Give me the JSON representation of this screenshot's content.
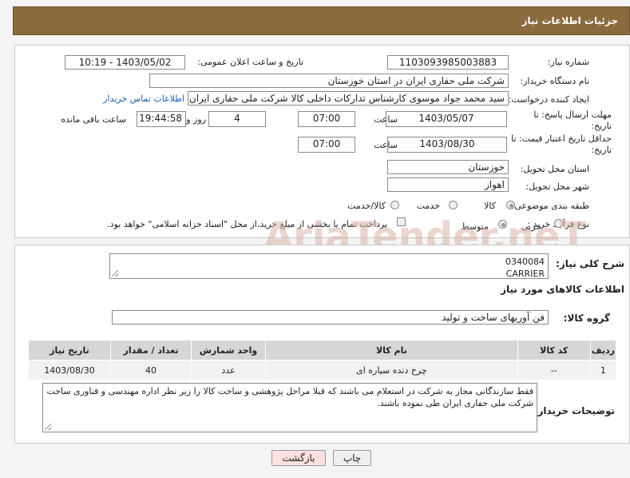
{
  "header": {
    "title": "جزئیات اطلاعات نیاز"
  },
  "form": {
    "need_number": {
      "label": "شماره نیاز:",
      "value": "1103093985003883"
    },
    "announce_datetime": {
      "label": "تاریخ و ساعت اعلان عمومی:",
      "value": "1403/05/02 - 10:19"
    },
    "buyer_org": {
      "label": "نام دستگاه خریدار:",
      "value": "شرکت ملی حفاری ایران در استان خوزستان"
    },
    "requester": {
      "label": "ایجاد کننده درخواست:",
      "value": "سید محمد جواد موسوی کارشناس تدارکات داخلی کالا شرکت ملی حفاری ایران",
      "contact_link": "اطلاعات تماس خریدار"
    },
    "reply_deadline": {
      "label": "مهلت ارسال پاسخ: تا تاریخ:",
      "date": "1403/05/07",
      "time_label": "ساعت",
      "time": "07:00",
      "days": "4",
      "days_label": "روز و",
      "remaining": "19:44:58",
      "remaining_label": "ساعت باقی مانده"
    },
    "price_validity": {
      "label": "حداقل تاریخ اعتبار قیمت: تا تاریخ:",
      "date": "1403/08/30",
      "time_label": "ساعت",
      "time": "07:00"
    },
    "delivery_province": {
      "label": "استان محل تحویل:",
      "value": "خوزستان"
    },
    "delivery_city": {
      "label": "شهر محل تحویل:",
      "value": "اهواز"
    },
    "category": {
      "label": "طبقه بندی موضوعی:",
      "options": [
        "کالا",
        "خدمت",
        "کالا/خدمت"
      ],
      "selected": "کالا"
    },
    "purchase_type": {
      "label": "نوع فرآیند خرید :",
      "options": [
        "جزیی",
        "متوسط"
      ],
      "selected": "متوسط",
      "note": "پرداخت تمام یا بخشی از مبلغ خرید،از محل \"اسناد خزانه اسلامی\" خواهد بود."
    }
  },
  "description": {
    "label": "شرح کلی نیاز:",
    "line1": "0340084",
    "line2": "CARRIER"
  },
  "goods_info": {
    "title": "اطلاعات کالاهای مورد نیاز"
  },
  "goods_group": {
    "label": "گروه کالا:",
    "value": "فن آوریهای ساخت و تولید"
  },
  "table": {
    "headers": [
      "ردیف",
      "کد کالا",
      "نام کالا",
      "واحد شمارش",
      "تعداد / مقدار",
      "تاریخ نیاز"
    ],
    "rows": [
      [
        "1",
        "--",
        "چرخ دنده سیاره ای",
        "عدد",
        "40",
        "1403/08/30"
      ]
    ]
  },
  "buyer_notes": {
    "label": "توضیحات خریدار:",
    "text": "فقط سازندگانی مجاز به شرکت در استعلام می باشند که قبلا مراحل پژوهشی و ساخت کالا را زیر نظر اداره مهندسی و فناوری ساخت شرکت ملی حفاری ایران طی نموده باشند."
  },
  "buttons": {
    "print": "چاپ",
    "back": "بازگشت"
  },
  "watermark": "AriaTender.neT",
  "colors": {
    "header_bg": "#8b6b3d",
    "link": "#1a5fb4",
    "back_button_bg": "#fde0e0"
  }
}
